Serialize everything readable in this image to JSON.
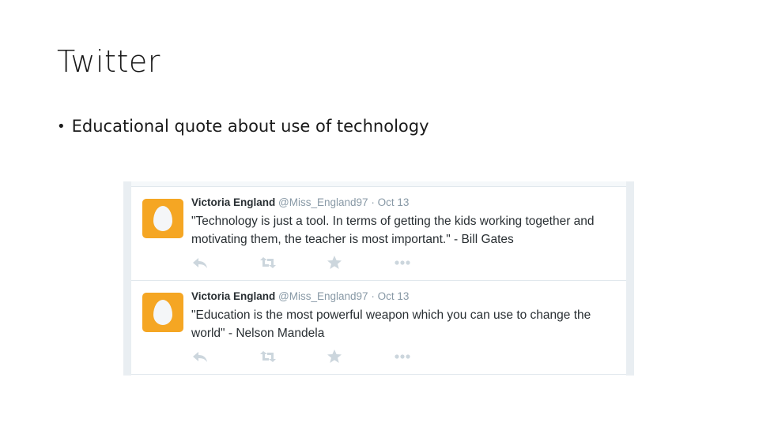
{
  "slide": {
    "title": "Twitter",
    "bullet": "Educational quote about use of technology"
  },
  "tweets": [
    {
      "display_name": "Victoria England",
      "handle": "@Miss_England97",
      "separator": "·",
      "date": "Oct 13",
      "text": "\"Technology is just a tool. In terms of getting the kids working together and motivating them, the teacher is most important.\" - Bill Gates"
    },
    {
      "display_name": "Victoria England",
      "handle": "@Miss_England97",
      "separator": "·",
      "date": "Oct 13",
      "text": "\"Education is the most powerful weapon which you can use to change the world\" - Nelson Mandela"
    }
  ],
  "icons": {
    "reply": "reply-icon",
    "retweet": "retweet-icon",
    "favorite": "star-icon",
    "more": "more-icon",
    "avatar": "egg-avatar-icon"
  },
  "colors": {
    "avatar_bg": "#f5a623",
    "name": "#292f33",
    "meta": "#8899a6",
    "action_icon": "#ccd6dd"
  }
}
